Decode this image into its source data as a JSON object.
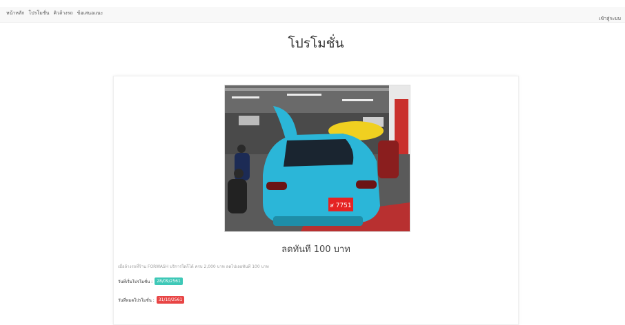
{
  "nav": {
    "items": [
      {
        "label": "หน้าหลัก"
      },
      {
        "label": "โปรโมชั่น"
      },
      {
        "label": "คิวล้างรถ"
      },
      {
        "label": "ข้อเสนอแนะ"
      }
    ],
    "login_label": "เข้าสู่ระบบ"
  },
  "page": {
    "title": "โปรโมชั่น"
  },
  "promo": {
    "title": "ลดทันที 100 บาท",
    "description": "เมื่อล้างรถที่ร้าน FORWASH บริการใดก็ได้ ครบ 2,000 บาท ลดไปเลยทันที 100 บาท",
    "start_label": "วันที่เริ่มโปรโมชั่น :",
    "start_date": "28/09/2561",
    "end_label": "วันที่หมดโปรโมชั่น :",
    "end_date": "31/10/2561",
    "plate_text": "ส 7751"
  },
  "colors": {
    "start_badge": "#3ec8b7",
    "end_badge": "#e84545",
    "car": "#2bb6d8"
  }
}
